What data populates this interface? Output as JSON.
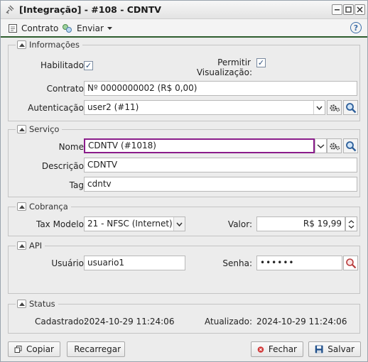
{
  "window": {
    "title": "[Integração] - #108 - CDNTV"
  },
  "toolbar": {
    "contrato_label": "Contrato",
    "enviar_label": "Enviar"
  },
  "informacoes": {
    "legend": "Informações",
    "habilitado_label": "Habilitado:",
    "habilitado_checked": true,
    "permitir_label_1": "Permitir",
    "permitir_label_2": "Visualização:",
    "permitir_checked": true,
    "contrato_label": "Contrato:",
    "contrato_value": "Nº 0000000002 (R$ 0,00)",
    "autenticacao_label": "Autenticação:",
    "autenticacao_value": "user2 (#11)"
  },
  "servico": {
    "legend": "Serviço",
    "nome_label": "Nome:",
    "nome_value": "CDNTV  (#1018)",
    "descricao_label": "Descrição:",
    "descricao_value": "CDNTV",
    "tag_label": "Tag:",
    "tag_value": "cdntv"
  },
  "cobranca": {
    "legend": "Cobrança",
    "tax_label": "Tax Modelo:",
    "tax_value": "21 - NFSC (Internet)",
    "valor_label": "Valor:",
    "valor_value": "R$ 19,99"
  },
  "api": {
    "legend": "API",
    "usuario_label": "Usuário:",
    "usuario_value": "usuario1",
    "senha_label": "Senha:",
    "senha_value": "••••••"
  },
  "status": {
    "legend": "Status",
    "cadastrado_label": "Cadastrado:",
    "cadastrado_value": "2024-10-29 11:24:06",
    "atualizado_label": "Atualizado:",
    "atualizado_value": "2024-10-29 11:24:06"
  },
  "footer": {
    "copiar_label": "Copiar",
    "recarregar_label": "Recarregar",
    "fechar_label": "Fechar",
    "salvar_label": "Salvar"
  },
  "colors": {
    "accent_green": "#2e5d2e",
    "focus_purple": "#8a1c8a",
    "close_red": "#d23b3b",
    "save_blue": "#1f4f8a"
  }
}
